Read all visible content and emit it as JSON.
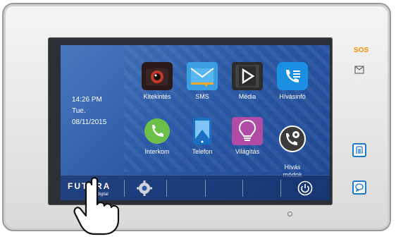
{
  "clock": {
    "time": "14:26  PM",
    "day": "Tue.",
    "date": "08/11/2015"
  },
  "apps": [
    {
      "label": "Kitekintés",
      "icon": "camera-icon"
    },
    {
      "label": "SMS",
      "icon": "envelope-icon"
    },
    {
      "label": "Média",
      "icon": "play-icon"
    },
    {
      "label": "Hívásinfó",
      "icon": "call-log-icon"
    },
    {
      "label": "Interkom",
      "icon": "phone-icon"
    },
    {
      "label": "Telefon",
      "icon": "tablet-icon"
    },
    {
      "label": "Világítás",
      "icon": "lightbulb-icon"
    },
    {
      "label": "Hívás\nmódok",
      "icon": "phone-settings-icon"
    }
  ],
  "taskbar": {
    "logo": "FUTURA",
    "logo_sub": "digital"
  },
  "side": {
    "sos_label": "SOS"
  },
  "colors": {
    "accent": "#1f78c8",
    "sos": "#f39200",
    "screen": "#2b5aa6"
  }
}
